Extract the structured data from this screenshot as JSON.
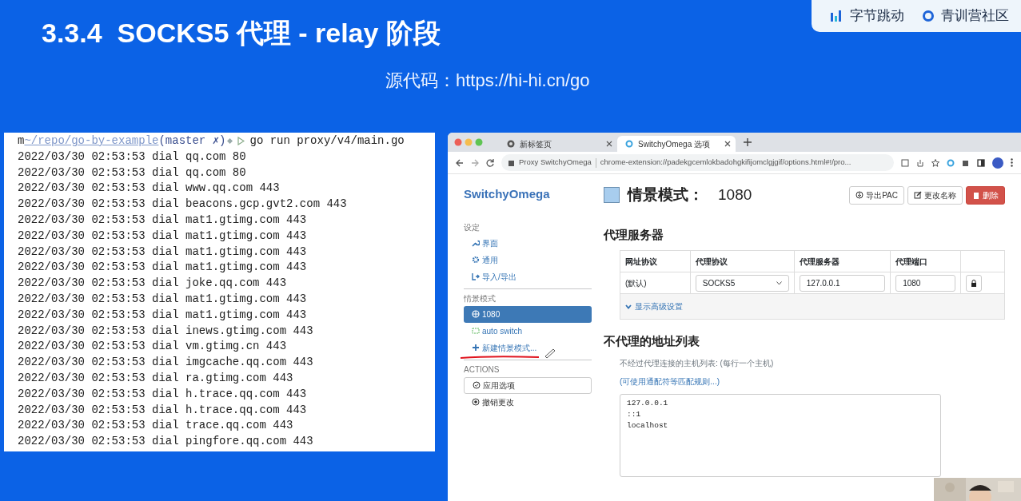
{
  "slide": {
    "title": "3.3.4  SOCKS5 代理 - relay 阶段",
    "source": "源代码：https://hi-hi.cn/go",
    "brands": [
      "字节跳动",
      "青训营社区"
    ]
  },
  "terminal": {
    "user": "m",
    "path": "~/repo/go-by-example",
    "branch": "(master ✗)",
    "command": "go run proxy/v4/main.go",
    "lines": [
      "2022/03/30 02:53:53 dial qq.com 80",
      "2022/03/30 02:53:53 dial qq.com 80",
      "2022/03/30 02:53:53 dial www.qq.com 443",
      "2022/03/30 02:53:53 dial beacons.gcp.gvt2.com 443",
      "2022/03/30 02:53:53 dial mat1.gtimg.com 443",
      "2022/03/30 02:53:53 dial mat1.gtimg.com 443",
      "2022/03/30 02:53:53 dial mat1.gtimg.com 443",
      "2022/03/30 02:53:53 dial mat1.gtimg.com 443",
      "2022/03/30 02:53:53 dial joke.qq.com 443",
      "2022/03/30 02:53:53 dial mat1.gtimg.com 443",
      "2022/03/30 02:53:53 dial mat1.gtimg.com 443",
      "2022/03/30 02:53:53 dial inews.gtimg.com 443",
      "2022/03/30 02:53:53 dial vm.gtimg.cn 443",
      "2022/03/30 02:53:53 dial imgcache.qq.com 443",
      "2022/03/30 02:53:53 dial ra.gtimg.com 443",
      "2022/03/30 02:53:53 dial h.trace.qq.com 443",
      "2022/03/30 02:53:53 dial h.trace.qq.com 443",
      "2022/03/30 02:53:53 dial trace.qq.com 443",
      "2022/03/30 02:53:53 dial pingfore.qq.com 443"
    ]
  },
  "browser": {
    "tabs": [
      {
        "title": "新标签页",
        "selected": false
      },
      {
        "title": "SwitchyOmega 选项",
        "selected": true
      }
    ],
    "address": {
      "site": "Proxy SwitchyOmega",
      "url": "chrome-extension://padekgcemlokbadohgkifijomclgjgif/options.html#!/pro..."
    },
    "app": {
      "brand": "SwitchyOmega",
      "sidebar": [
        {
          "heading": "设定",
          "items": [
            {
              "label": "界面",
              "kind": "link",
              "selected": false
            },
            {
              "label": "通用",
              "kind": "link",
              "selected": false
            },
            {
              "label": "导入/导出",
              "kind": "link",
              "selected": false
            }
          ]
        },
        {
          "heading": "情景模式",
          "items": [
            {
              "label": "1080",
              "kind": "link",
              "selected": true
            },
            {
              "label": "auto switch",
              "kind": "link",
              "selected": false
            },
            {
              "label": "新建情景模式...",
              "kind": "link",
              "selected": false
            }
          ]
        },
        {
          "heading": "ACTIONS",
          "items": [
            {
              "label": "应用选项",
              "kind": "outlined"
            },
            {
              "label": "撤销更改",
              "kind": "link"
            }
          ]
        }
      ],
      "profile": {
        "label": "情景模式：",
        "name": "1080",
        "color": "#a8cdee"
      },
      "buttons": [
        {
          "label": "导出PAC",
          "kind": "default"
        },
        {
          "label": "更改名称",
          "kind": "default"
        },
        {
          "label": "删除",
          "kind": "danger"
        }
      ],
      "proxy": {
        "heading": "代理服务器",
        "columns": [
          "网址协议",
          "代理协议",
          "代理服务器",
          "代理端口"
        ],
        "scheme": "(默认)",
        "protocol": "SOCKS5",
        "server": "127.0.0.1",
        "port": "1080",
        "advanced": "显示高级设置"
      },
      "bypass": {
        "heading": "不代理的地址列表",
        "help": "不经过代理连接的主机列表: (每行一个主机)",
        "link": "(可使用通配符等匹配规则...)",
        "list": "127.0.0.1\n::1\nlocalhost"
      }
    }
  }
}
